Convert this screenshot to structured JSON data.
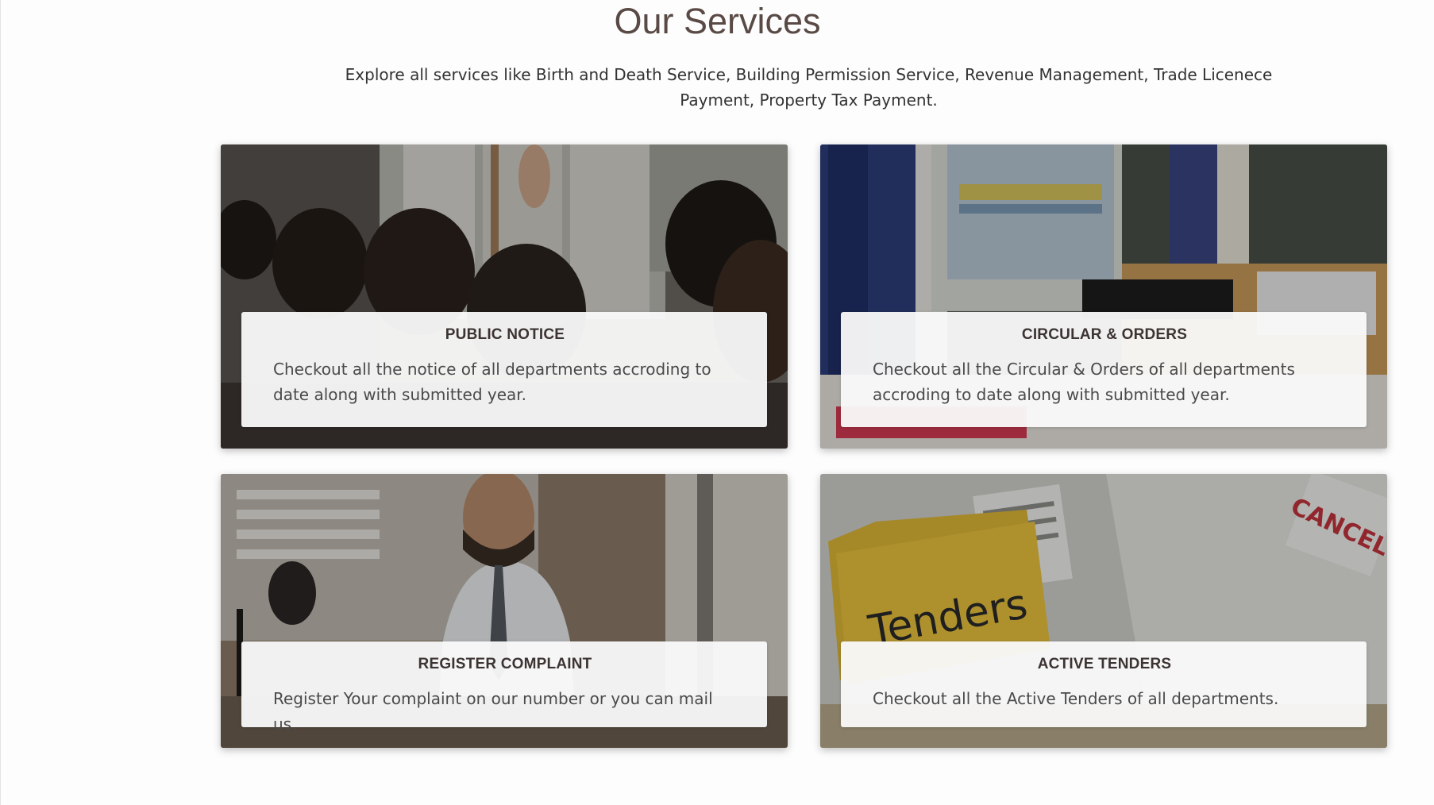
{
  "section": {
    "title": "Our Services",
    "subtitle": "Explore all services like Birth and Death Service, Building Permission Service, Revenue Management, Trade Licenece Payment, Property Tax Payment."
  },
  "cards": [
    {
      "title": "PUBLIC NOTICE",
      "description": "Checkout all the notice of all departments accroding to date along with submitted year.",
      "image": "people-at-notice-board-photo"
    },
    {
      "title": "CIRCULAR & ORDERS",
      "description": "Checkout all the Circular & Orders of all departments accroding to date along with submitted year.",
      "image": "office-computer-desk-photo"
    },
    {
      "title": "REGISTER COMPLAINT",
      "description": "Register Your complaint on our number or you can mail us.",
      "image": "man-in-office-photo"
    },
    {
      "title": "ACTIVE TENDERS",
      "description": "Checkout all the Active Tenders of all departments.",
      "image": "tenders-folder-photo",
      "image_text": "Tenders"
    }
  ]
}
